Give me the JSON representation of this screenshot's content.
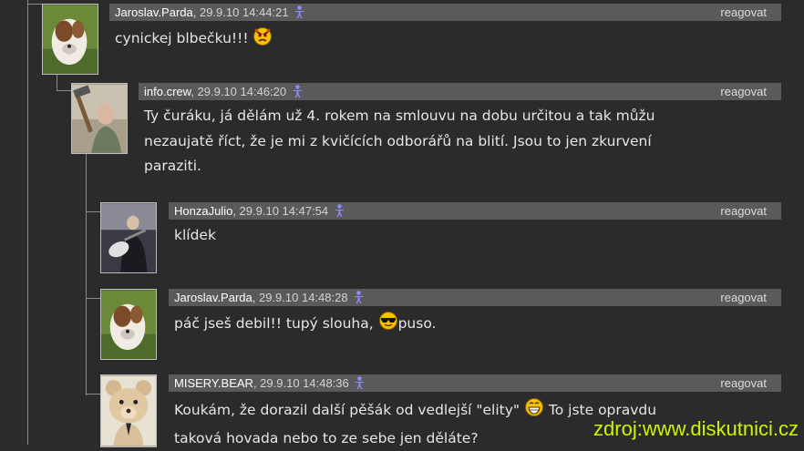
{
  "comments": [
    {
      "author": "Jaroslav.Parda",
      "date": ", 29.9.10 14:44:21",
      "reply": "reagovat",
      "text": "cynickej blbečku!!!",
      "smiley": "angry-smiley-icon"
    },
    {
      "author": "info.crew",
      "date": ", 29.9.10 14:46:20",
      "reply": "reagovat",
      "lines": [
        "Ty čuráku, já dělám už 4. rokem na smlouvu na dobu určitou a tak můžu",
        "nezaujatě říct, že je mi z kvičících odborářů na blití. Jsou to jen zkurvení",
        "paraziti."
      ]
    },
    {
      "author": "HonzaJulio",
      "date": ", 29.9.10 14:47:54",
      "reply": "reagovat",
      "text": "klídek"
    },
    {
      "author": "Jaroslav.Parda",
      "date": ", 29.9.10 14:48:28",
      "reply": "reagovat",
      "text_before": "páč jseš debil!! tupý slouha, ",
      "text_after": "puso.",
      "smiley": "cool-sunglasses-smiley-icon"
    },
    {
      "author": "MISERY.BEAR",
      "date": ", 29.9.10 14:48:36",
      "reply": "reagovat",
      "line1_before": "Koukám, že dorazil další pěšák od vedlejší \"elity\" ",
      "line1_after": " To jste opravdu",
      "line2": "taková hovada nebo to ze sebe jen děláte?",
      "smiley": "grinning-smiley-icon"
    }
  ],
  "watermark": "zdroj:www.diskutnici.cz",
  "colors": {
    "background": "#2b2b2b",
    "header": "#5a5a5a",
    "watermark": "#c9f700",
    "user_icon": "#8c8cff"
  }
}
